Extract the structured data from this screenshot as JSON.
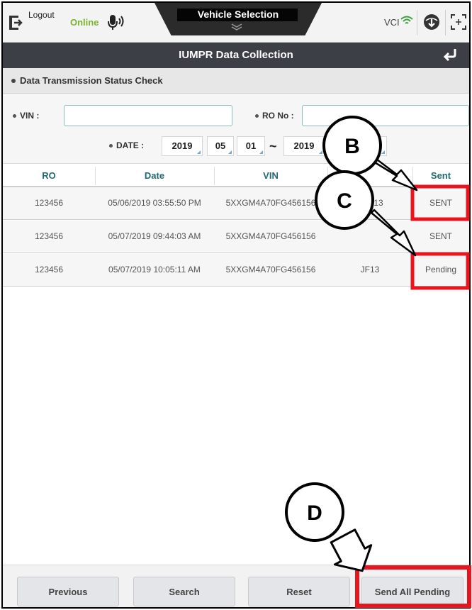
{
  "topbar": {
    "logout_label": "Logout",
    "online_label": "Online",
    "vehicle_selection_label": "Vehicle Selection",
    "vci_label": "VCI",
    "icons": [
      "logout-icon",
      "voice-icon",
      "chevron-down-icon",
      "wifi-icon",
      "download-icon",
      "screen-capture-icon"
    ]
  },
  "titlebar": {
    "title": "IUMPR Data Collection",
    "back_icon": "back-icon"
  },
  "section": {
    "heading": "Data Transmission Status Check"
  },
  "filter": {
    "vin_label": "VIN :",
    "vin_value": "",
    "ro_label": "RO No :",
    "ro_value": "",
    "date_label": "DATE :",
    "from_year": "2019",
    "from_month": "05",
    "from_day": "01",
    "range_separator": "~",
    "to_year": "2019"
  },
  "table": {
    "columns": [
      "RO",
      "Date",
      "VIN",
      "",
      "Sent"
    ],
    "rows": [
      {
        "ro": "123456",
        "date": "05/06/2019 03:55:50 PM",
        "vin": "5XXGM4A70FG456156",
        "model": "13",
        "sent": "SENT"
      },
      {
        "ro": "123456",
        "date": "05/07/2019 09:44:03 AM",
        "vin": "5XXGM4A70FG456156",
        "model": "",
        "sent": "SENT"
      },
      {
        "ro": "123456",
        "date": "05/07/2019 10:05:11 AM",
        "vin": "5XXGM4A70FG456156",
        "model": "JF13",
        "sent": "Pending"
      }
    ]
  },
  "buttons": {
    "previous": "Previous",
    "search": "Search",
    "reset": "Reset",
    "send_all_pending": "Send All Pending"
  },
  "annotations": {
    "callouts": [
      "B",
      "C",
      "D"
    ],
    "highlight_color": "#e8141e"
  },
  "colors": {
    "online": "#7bb32e",
    "titlebar": "#3d3f46",
    "header_text": "#1f6a72",
    "highlight": "#e8141e"
  }
}
